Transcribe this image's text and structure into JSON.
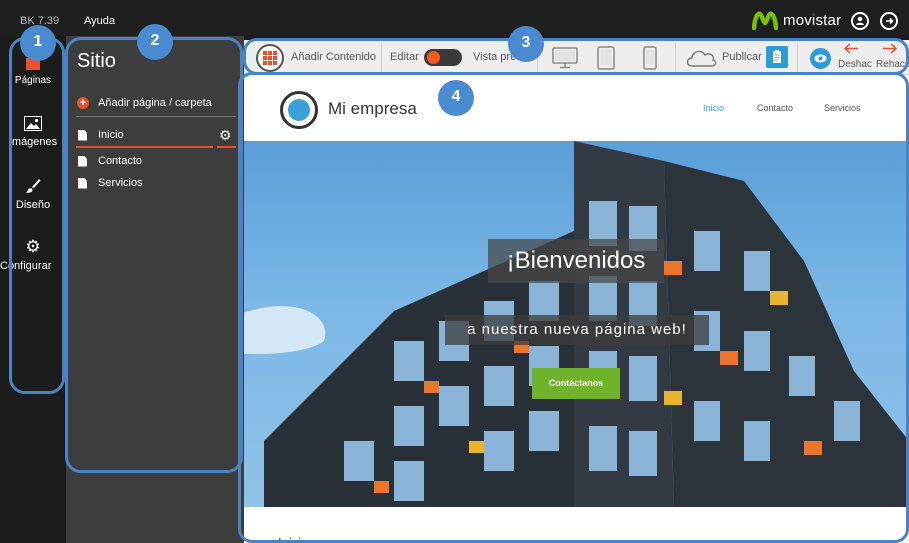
{
  "topbar": {
    "version": "BK 7.39",
    "help": "Ayuda",
    "brand": "movistar",
    "icons": [
      "user-circle-icon",
      "logout-icon"
    ]
  },
  "rail": {
    "items": [
      {
        "label": "Páginas",
        "icon": "pages-icon"
      },
      {
        "label": "Imágenes",
        "icon": "image-icon"
      },
      {
        "label": "Diseño",
        "icon": "brush-icon"
      },
      {
        "label": "Configurar",
        "icon": "gear-icon"
      }
    ]
  },
  "site": {
    "title": "Sitio",
    "add_page": "Añadir página / carpeta",
    "pages": [
      "Inicio",
      "Contacto",
      "Servicios"
    ],
    "selected": "Inicio"
  },
  "toolbar": {
    "add_content": "Añadir Contenido",
    "edit": "Editar",
    "preview": "Vista previa",
    "publish": "Publicar",
    "undo": "Deshac",
    "redo": "Rehace"
  },
  "preview": {
    "company": "Mi empresa",
    "nav": [
      "Inicio",
      "Contacto",
      "Servicios"
    ],
    "hero_title": "¡Bienvenidos",
    "hero_subtitle": "a nuestra nueva página web!",
    "hero_button": "Contáctanos",
    "below": "Inicio"
  },
  "annotations": {
    "bubble_1": "1",
    "bubble_2": "2",
    "bubble_3": "3",
    "bubble_4": "4"
  },
  "colors": {
    "accent": "#e9502b",
    "highlight": "#4a82c8",
    "link": "#3aa0d8",
    "button": "#6fb22b"
  }
}
